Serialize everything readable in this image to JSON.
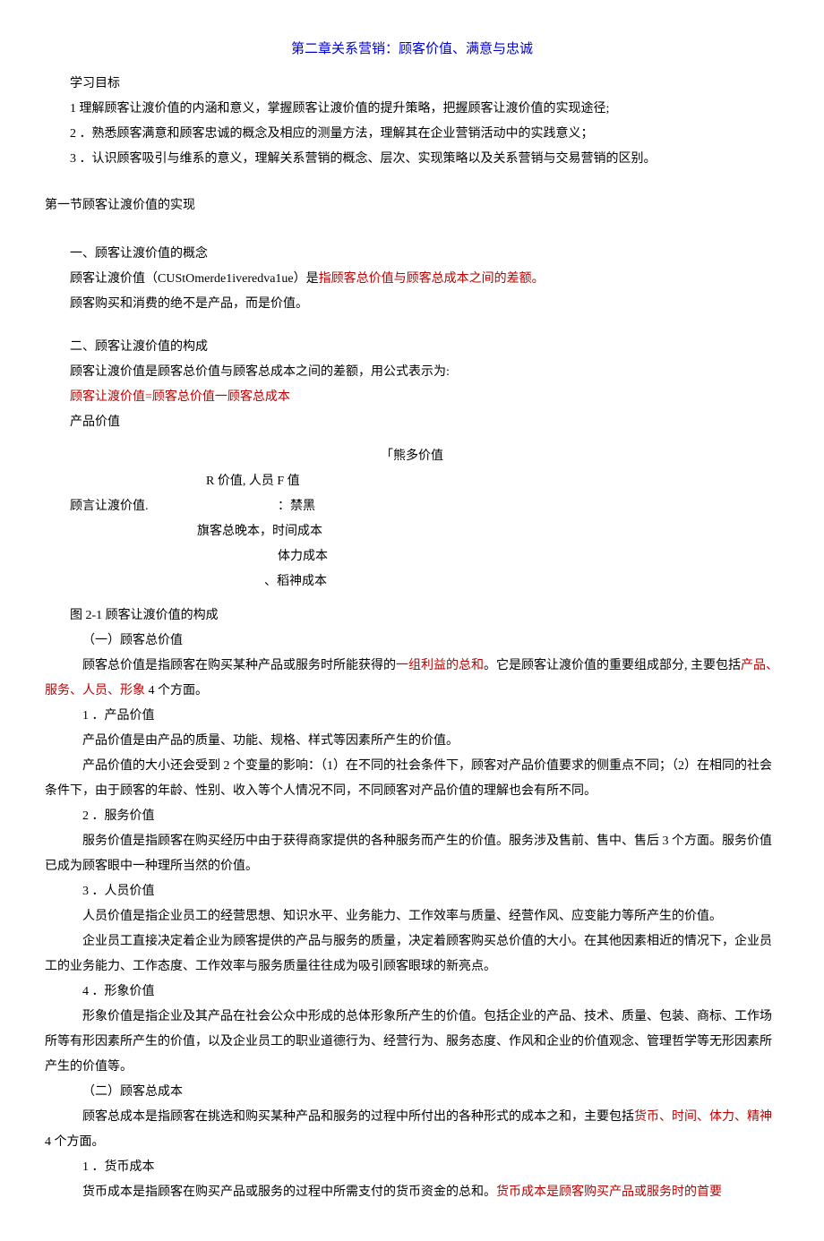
{
  "title": "第二章关系营销：顾客价值、满意与忠诚",
  "studyGoals": {
    "heading": "学习目标",
    "items": [
      "1 理解顾客让渡价值的内涵和意义，掌握顾客让渡价值的提升策略，把握顾客让渡价值的实现途径;",
      "2 ．熟悉顾客满意和顾客忠诚的概念及相应的测量方法，理解其在企业营销活动中的实践意义；",
      "3 ．认识顾客吸引与维系的意义，理解关系营销的概念、层次、实现策略以及关系营销与交易营销的区别。"
    ]
  },
  "section1": {
    "heading": "第一节顾客让渡价值的实现",
    "sub1": {
      "heading": "一、顾客让渡价值的概念",
      "line1a": "顾客让渡价值（CUStOmerde1iveredva1ue）是",
      "line1b": "指顾客总价值与顾客总成本之间的差额。",
      "line2": "顾客购买和消费的绝不是产品，而是价值。"
    },
    "sub2": {
      "heading": "二、顾客让渡价值的构成",
      "line1": "顾客让渡价值是顾客总价值与顾客总成本之间的差额，用公式表示为:",
      "formula": "顾客让渡价值=顾客总价值一顾客总成本",
      "line2": "产品价值",
      "struct": {
        "l1": "「熊多价值",
        "l2": "R 价值, 人员 F 值",
        "l3a": "顾言让渡价值.",
        "l3b": "：禁黑",
        "l4": "旗客总晚本，时间成本",
        "l5": "体力成本",
        "l6": "、稻神成本"
      },
      "figLabel": "图 2-1 顾客让渡价值的构成"
    },
    "s21": {
      "heading": "（一）顾客总价值",
      "p1a": "顾客总价值是指顾客在购买某种产品或服务时所能获得的",
      "p1b": "一组利益的总和",
      "p1c": "。它是顾客让渡价值的重要组成部分, 主要包括",
      "p1d": "产品、服务、人员、形象",
      "p1e": " 4 个方面。"
    },
    "prod": {
      "heading": "1 ．产品价值",
      "p1": "产品价值是由产品的质量、功能、规格、样式等因素所产生的价值。",
      "p2": "产品价值的大小还会受到 2 个变量的影响：（1）在不同的社会条件下，顾客对产品价值要求的侧重点不同；（2）在相同的社会条件下，由于顾客的年龄、性别、收入等个人情况不同，不同顾客对产品价值的理解也会有所不同。"
    },
    "serv": {
      "heading": "2 ．服务价值",
      "p1": "服务价值是指顾客在购买经历中由于获得商家提供的各种服务而产生的价值。服务涉及售前、售中、售后 3 个方面。服务价值已成为顾客眼中一种理所当然的价值。"
    },
    "pers": {
      "heading": "3 ．人员价值",
      "p1": "人员价值是指企业员工的经营思想、知识水平、业务能力、工作效率与质量、经营作风、应变能力等所产生的价值。",
      "p2": "企业员工直接决定着企业为顾客提供的产品与服务的质量，决定着顾客购买总价值的大小。在其他因素相近的情况下，企业员工的业务能力、工作态度、工作效率与服务质量往往成为吸引顾客眼球的新亮点。"
    },
    "img": {
      "heading": "4 ．形象价值",
      "p1": "形象价值是指企业及其产品在社会公众中形成的总体形象所产生的价值。包括企业的产品、技术、质量、包装、商标、工作场所等有形因素所产生的价值，以及企业员工的职业道德行为、经营行为、服务态度、作风和企业的价值观念、管理哲学等无形因素所产生的价值等。"
    },
    "s22": {
      "heading": "（二）顾客总成本",
      "p1a": "顾客总成本是指顾客在挑选和购买某种产品和服务的过程中所付出的各种形式的成本之和，主要包括",
      "p1b": "货币、时间、体力、精神",
      "p1c": " 4 个方面。"
    },
    "money": {
      "heading": "1 ．货币成本",
      "p1a": "货币成本是指顾客在购买产品或服务的过程中所需支付的货币资金的总和。",
      "p1b": "货币成本是顾客购买产品或服务时的首要"
    }
  }
}
